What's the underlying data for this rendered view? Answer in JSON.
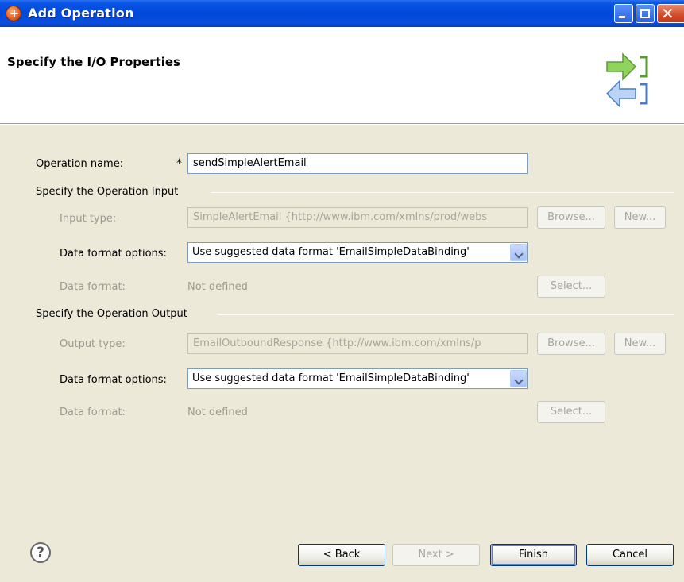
{
  "window": {
    "title": "Add Operation"
  },
  "header": {
    "title": "Specify the I/O Properties"
  },
  "form": {
    "operation_name_label": "Operation name:",
    "required_marker": "*",
    "operation_name_value": "sendSimpleAlertEmail",
    "input_group": {
      "title": "Specify the Operation Input",
      "type_label": "Input type:",
      "type_value": "SimpleAlertEmail  {http://www.ibm.com/xmlns/prod/webs",
      "browse_label": "Browse...",
      "new_label": "New...",
      "format_options_label": "Data format options:",
      "format_options_value": "Use suggested data format 'EmailSimpleDataBinding'",
      "data_format_label": "Data format:",
      "data_format_value": "Not defined",
      "select_label": "Select..."
    },
    "output_group": {
      "title": "Specify the Operation Output",
      "type_label": "Output type:",
      "type_value": "EmailOutboundResponse  {http://www.ibm.com/xmlns/p",
      "browse_label": "Browse...",
      "new_label": "New...",
      "format_options_label": "Data format options:",
      "format_options_value": "Use suggested data format 'EmailSimpleDataBinding'",
      "data_format_label": "Data format:",
      "data_format_value": "Not defined",
      "select_label": "Select..."
    }
  },
  "footer": {
    "help_icon": "?",
    "back_label": "< Back",
    "next_label": "Next >",
    "finish_label": "Finish",
    "cancel_label": "Cancel"
  },
  "icons": {
    "app": "plus-icon",
    "header": "io-arrows-icon",
    "help": "help-icon"
  },
  "colors": {
    "titlebar": "#0a55e6",
    "dialog_bg": "#ece9d8",
    "header_bg": "#ffffff",
    "disabled_text": "#9c9a90"
  }
}
